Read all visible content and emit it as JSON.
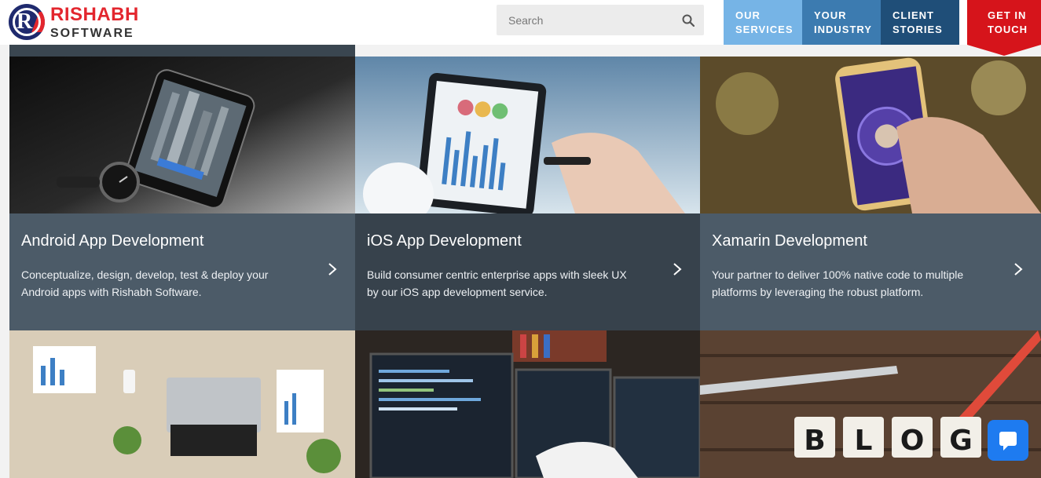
{
  "brand": {
    "line1": "RISHABH",
    "line2": "SOFTWARE",
    "logo_letter": "R"
  },
  "search": {
    "placeholder": "Search"
  },
  "nav": [
    {
      "line1": "OUR",
      "line2": "SERVICES"
    },
    {
      "line1": "YOUR",
      "line2": "INDUSTRY"
    },
    {
      "line1": "CLIENT",
      "line2": "STORIES"
    },
    {
      "line1": "GET IN",
      "line2": "TOUCH"
    }
  ],
  "cards": [
    {
      "title": "Android App Development",
      "desc": "Conceptualize, design, develop, test & deploy your Android apps with Rishabh Software."
    },
    {
      "title": "iOS App Development",
      "desc": "Build consumer centric enterprise apps with sleek UX by our iOS app development service."
    },
    {
      "title": "Xamarin Development",
      "desc": "Your partner to deliver 100% native code to multiple platforms by leveraging the robust platform."
    }
  ],
  "blog_letters": [
    "B",
    "L",
    "O",
    "G"
  ],
  "colors": {
    "accent_red": "#d6141b",
    "nav_light": "#76b4e6",
    "nav_mid": "#3c7bb0",
    "nav_dark": "#1f4e78",
    "card_slate": "#4c5b68",
    "card_dark": "#37424c",
    "chat_blue": "#1e7bf0"
  }
}
